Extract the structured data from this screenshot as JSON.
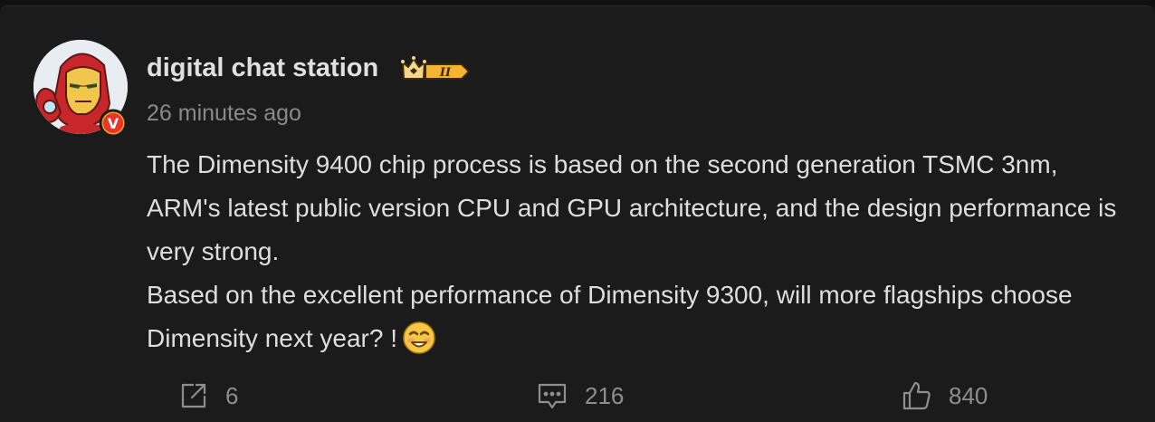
{
  "post": {
    "author": {
      "name": "digital chat station",
      "verified_badge_letter": "V",
      "level_badge_label": "II",
      "avatar_icon": "iron-man-avatar-icon",
      "verified_color": "#f2a31b"
    },
    "timestamp": "26 minutes ago",
    "paragraphs": [
      "The Dimensity 9400 chip process is based on the second generation TSMC 3nm, ARM's latest public version CPU and GPU architecture, and the design performance is very strong.",
      "Based on the excellent performance of Dimensity 9300, will more flagships choose Dimensity next year? !"
    ],
    "emoji": "smiling-emoji-icon"
  },
  "actions": {
    "share": {
      "icon": "share-icon",
      "count": "6"
    },
    "comment": {
      "icon": "comment-icon",
      "count": "216"
    },
    "like": {
      "icon": "thumbs-up-icon",
      "count": "840"
    }
  },
  "theme": {
    "background": "#1b1b1b",
    "text": "#dedede",
    "muted": "#8a8a8a",
    "badge_gold": "#f6b73c"
  }
}
